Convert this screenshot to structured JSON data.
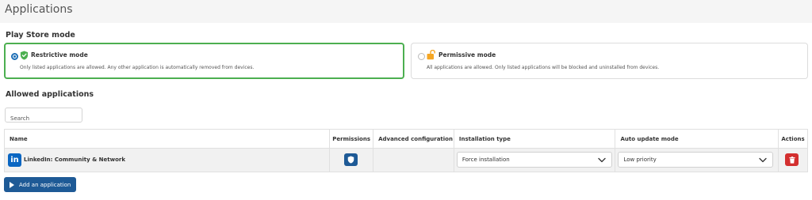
{
  "page": {
    "title": "Applications"
  },
  "play_store_mode": {
    "label": "Play Store mode",
    "options": [
      {
        "title": "Restrictive mode",
        "description": "Only listed applications are allowed. Any other application is automatically removed from devices.",
        "selected": true,
        "icon": "shield-check-icon",
        "icon_color": "#4caf50"
      },
      {
        "title": "Permissive mode",
        "description": "All applications are allowed. Only listed applications will be blocked and uninstalled from devices.",
        "selected": false,
        "icon": "unlock-icon",
        "icon_color": "#f5a623"
      }
    ]
  },
  "allowed_applications": {
    "label": "Allowed applications",
    "search": {
      "placeholder": "Search",
      "value": ""
    },
    "columns": {
      "name": "Name",
      "permissions": "Permissions",
      "advanced": "Advanced configuration",
      "installation_type": "Installation type",
      "auto_update": "Auto update mode",
      "actions": "Actions"
    },
    "rows": [
      {
        "app_name": "LinkedIn: Community & Network",
        "logo_text": "in",
        "logo_color": "#0a66c2",
        "permissions_icon": "shield-icon",
        "advanced_configuration": "",
        "installation_type": "Force installation",
        "auto_update_mode": "Low priority",
        "action_icon": "trash-icon"
      }
    ],
    "add_button": "Add an application"
  },
  "colors": {
    "accent": "#1e5a96",
    "selected_border": "#4caf50",
    "danger": "#d32f2f",
    "header_bg": "#f5f5f5",
    "row_bg": "#f1f1f1"
  }
}
